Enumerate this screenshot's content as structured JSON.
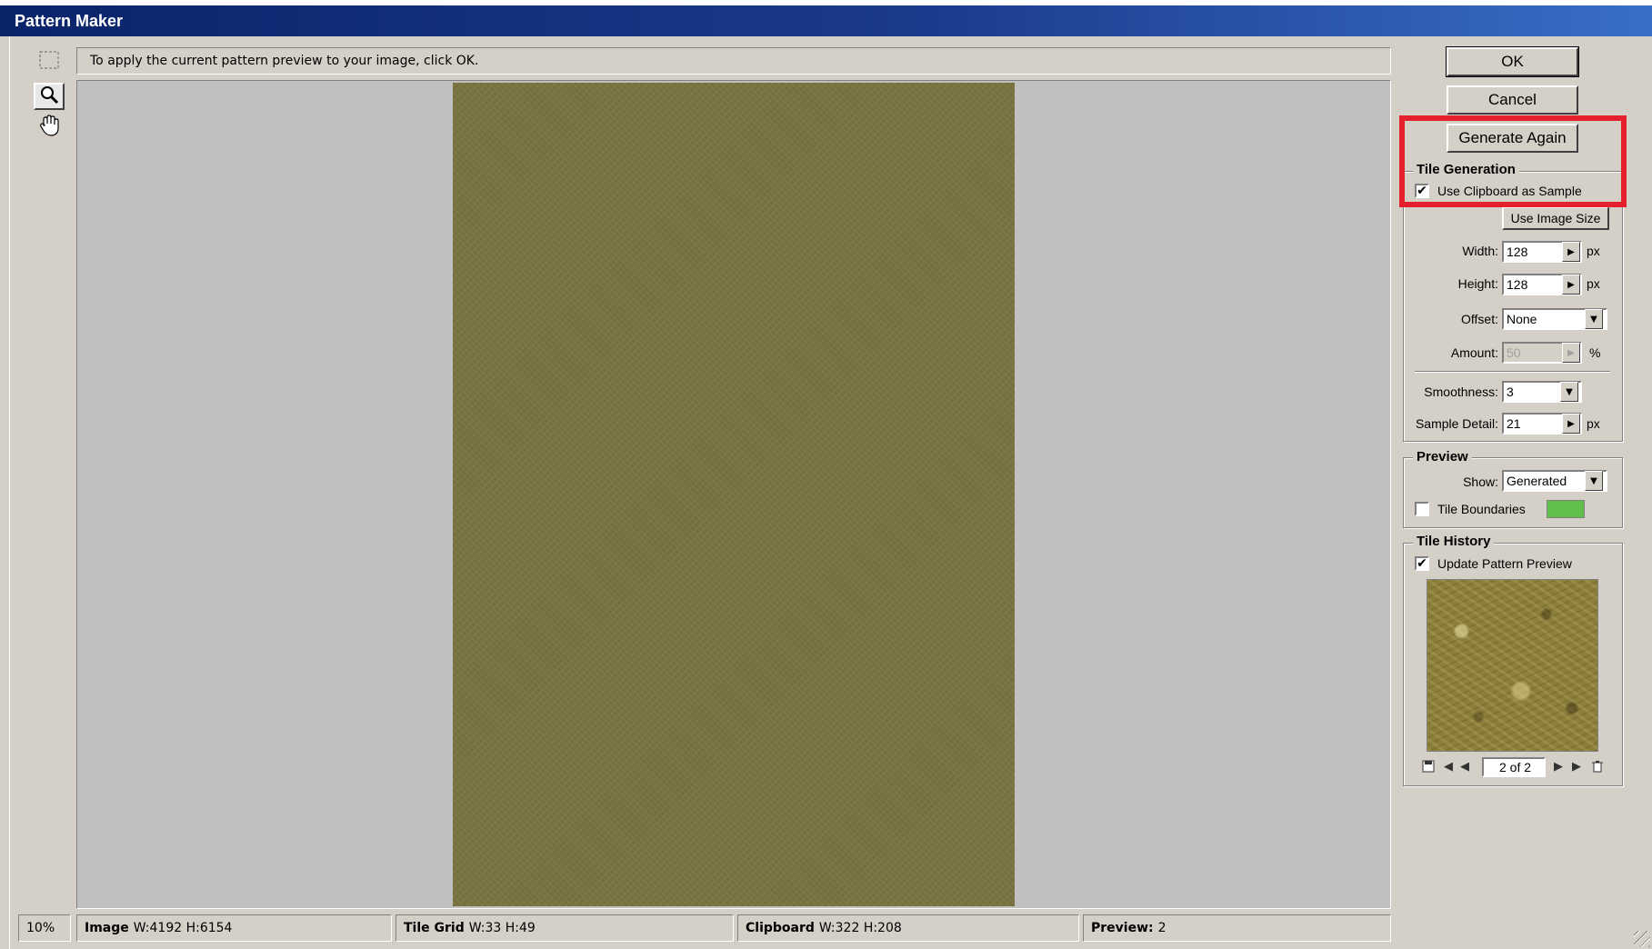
{
  "window": {
    "title": "Pattern Maker"
  },
  "message": "To apply the current pattern preview to your image, click OK.",
  "tools": {
    "marquee": "marquee-icon",
    "zoom": "magnifier-icon",
    "hand": "hand-icon"
  },
  "buttons": {
    "ok": "OK",
    "cancel": "Cancel",
    "generate_again": "Generate Again",
    "use_image_size": "Use Image Size"
  },
  "tile_generation": {
    "title": "Tile Generation",
    "use_clipboard_label": "Use Clipboard as Sample",
    "use_clipboard_checked": true,
    "width_label": "Width:",
    "width_value": "128",
    "width_unit": "px",
    "height_label": "Height:",
    "height_value": "128",
    "height_unit": "px",
    "offset_label": "Offset:",
    "offset_value": "None",
    "amount_label": "Amount:",
    "amount_value": "50",
    "amount_unit": "%",
    "smoothness_label": "Smoothness:",
    "smoothness_value": "3",
    "sample_detail_label": "Sample Detail:",
    "sample_detail_value": "21",
    "sample_detail_unit": "px"
  },
  "preview": {
    "title": "Preview",
    "show_label": "Show:",
    "show_value": "Generated",
    "tile_boundaries_label": "Tile Boundaries",
    "tile_boundaries_checked": false,
    "boundary_color": "#5fbf4a"
  },
  "tile_history": {
    "title": "Tile History",
    "update_label": "Update Pattern Preview",
    "update_checked": true,
    "counter": "2 of 2"
  },
  "status": {
    "zoom": "10%",
    "image_label": "Image",
    "image_value": "W:4192 H:6154",
    "tilegrid_label": "Tile Grid",
    "tilegrid_value": "W:33 H:49",
    "clipboard_label": "Clipboard",
    "clipboard_value": "W:322 H:208",
    "preview_label": "Preview:",
    "preview_value": "2"
  },
  "colors": {
    "accent_highlight": "#e5202e",
    "pattern": "#7a7440",
    "titlebar": "#0a246a"
  }
}
